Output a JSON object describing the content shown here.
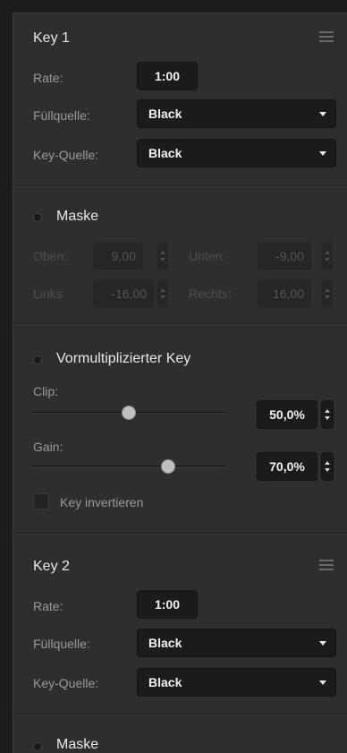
{
  "key1": {
    "title": "Key 1",
    "rate_label": "Rate:",
    "rate_value": "1:00",
    "fill_label": "Füllquelle:",
    "fill_value": "Black",
    "keysrc_label": "Key-Quelle:",
    "keysrc_value": "Black"
  },
  "mask1": {
    "title": "Maske",
    "top_label": "Oben:",
    "top_value": "9,00",
    "bottom_label": "Unten:",
    "bottom_value": "-9,00",
    "left_label": "Links:",
    "left_value": "-16,00",
    "right_label": "Rechts:",
    "right_value": "16,00"
  },
  "premult": {
    "title": "Vormultiplizierter Key",
    "clip_label": "Clip:",
    "clip_value": "50,0%",
    "clip_level": 0.5,
    "gain_label": "Gain:",
    "gain_value": "70,0%",
    "gain_level": 0.7,
    "invert_label": "Key invertieren"
  },
  "key2": {
    "title": "Key 2",
    "rate_label": "Rate:",
    "rate_value": "1:00",
    "fill_label": "Füllquelle:",
    "fill_value": "Black",
    "keysrc_label": "Key-Quelle:",
    "keysrc_value": "Black"
  },
  "mask2": {
    "title": "Maske"
  }
}
